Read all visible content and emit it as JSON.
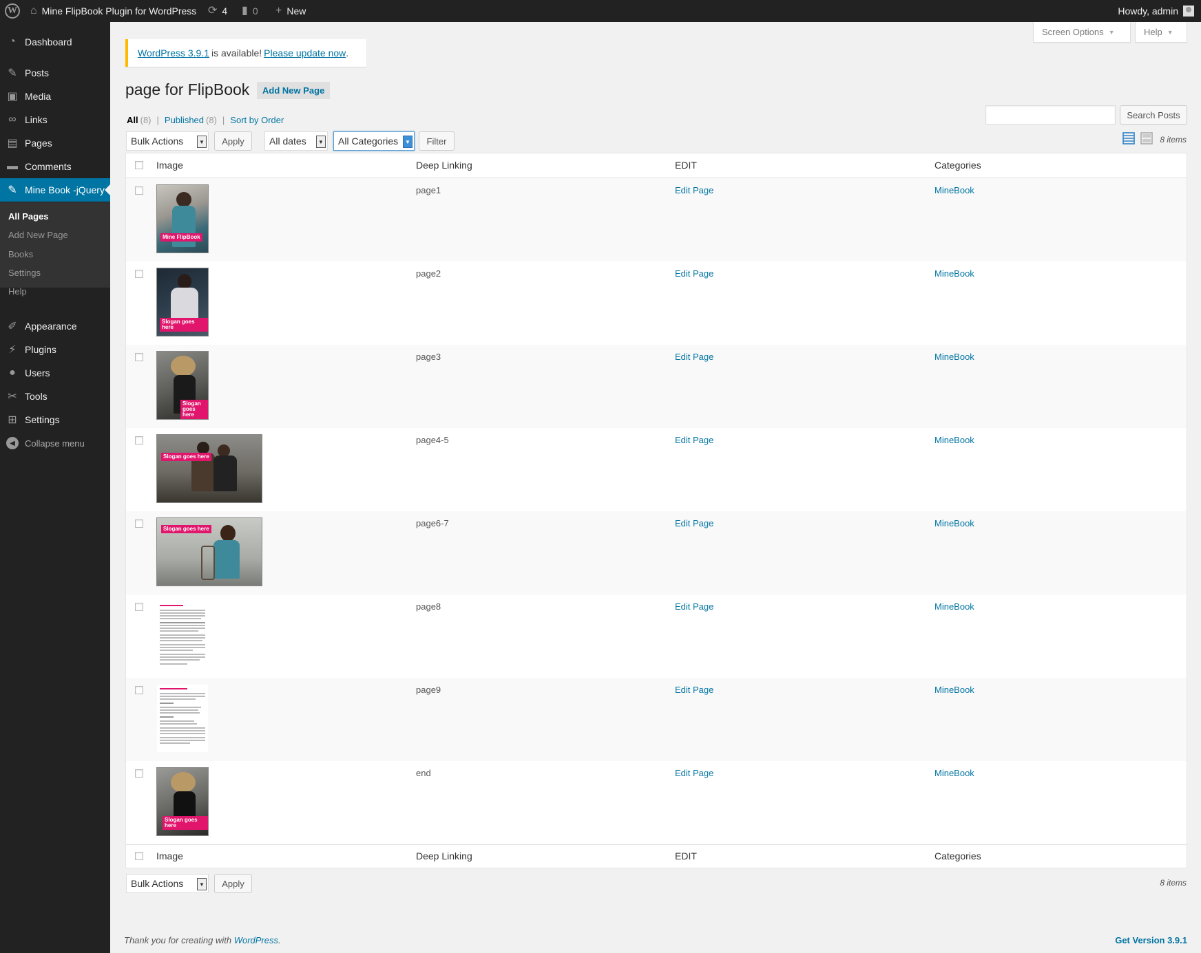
{
  "adminbar": {
    "site_name": "Mine FlipBook Plugin for WordPress",
    "updates_count": "4",
    "comments_count": "0",
    "new_label": "New",
    "howdy": "Howdy, admin"
  },
  "sidebar": {
    "items": [
      {
        "label": "Dashboard",
        "icon": "dashboard-icon"
      },
      {
        "label": "Posts",
        "icon": "pin-icon"
      },
      {
        "label": "Media",
        "icon": "media-icon"
      },
      {
        "label": "Links",
        "icon": "link-icon"
      },
      {
        "label": "Pages",
        "icon": "pages-icon"
      },
      {
        "label": "Comments",
        "icon": "comment-icon"
      },
      {
        "label": "Mine Book -jQuery",
        "icon": "pin-icon"
      },
      {
        "label": "Appearance",
        "icon": "brush-icon"
      },
      {
        "label": "Plugins",
        "icon": "plugin-icon"
      },
      {
        "label": "Users",
        "icon": "user-icon"
      },
      {
        "label": "Tools",
        "icon": "wrench-icon"
      },
      {
        "label": "Settings",
        "icon": "settings-icon"
      }
    ],
    "submenu": [
      "All Pages",
      "Add New Page",
      "Books",
      "Settings",
      "Help"
    ],
    "collapse_label": "Collapse menu"
  },
  "screen_meta": {
    "screen_options": "Screen Options",
    "help": "Help"
  },
  "notice": {
    "link1": "WordPress 3.9.1",
    "middle": "is available!",
    "link2": "Please update now",
    "end": "."
  },
  "page": {
    "title": "page for FlipBook",
    "add_new": "Add New Page"
  },
  "views": {
    "all": "All",
    "all_count": "(8)",
    "published": "Published",
    "published_count": "(8)",
    "sort": "Sort by Order"
  },
  "search": {
    "button": "Search Posts",
    "value": ""
  },
  "tablenav": {
    "bulk": "Bulk Actions",
    "apply": "Apply",
    "dates": "All dates",
    "categories": "All Categories",
    "filter": "Filter",
    "items": "8 items"
  },
  "table": {
    "columns": [
      "Image",
      "Deep Linking",
      "EDIT",
      "Categories"
    ],
    "rows": [
      {
        "deep_linking": "page1",
        "edit": "Edit Page",
        "category": "MineBook",
        "slogan": "Mine FlipBook"
      },
      {
        "deep_linking": "page2",
        "edit": "Edit Page",
        "category": "MineBook",
        "slogan": "Slogan goes here"
      },
      {
        "deep_linking": "page3",
        "edit": "Edit Page",
        "category": "MineBook",
        "slogan": "Slogan goes here"
      },
      {
        "deep_linking": "page4-5",
        "edit": "Edit Page",
        "category": "MineBook",
        "slogan": "Slogan goes here"
      },
      {
        "deep_linking": "page6-7",
        "edit": "Edit Page",
        "category": "MineBook",
        "slogan": "Slogan goes here"
      },
      {
        "deep_linking": "page8",
        "edit": "Edit Page",
        "category": "MineBook"
      },
      {
        "deep_linking": "page9",
        "edit": "Edit Page",
        "category": "MineBook"
      },
      {
        "deep_linking": "end",
        "edit": "Edit Page",
        "category": "MineBook",
        "slogan": "Slogan goes here"
      }
    ]
  },
  "footer": {
    "thanks": "Thank you for creating with",
    "wp": "WordPress",
    "dot": ".",
    "version": "Get Version 3.9.1"
  },
  "colors": {
    "accent": "#0074a2",
    "sidebar": "#222222",
    "notice": "#ffba00",
    "slogan": "#e0156b"
  }
}
